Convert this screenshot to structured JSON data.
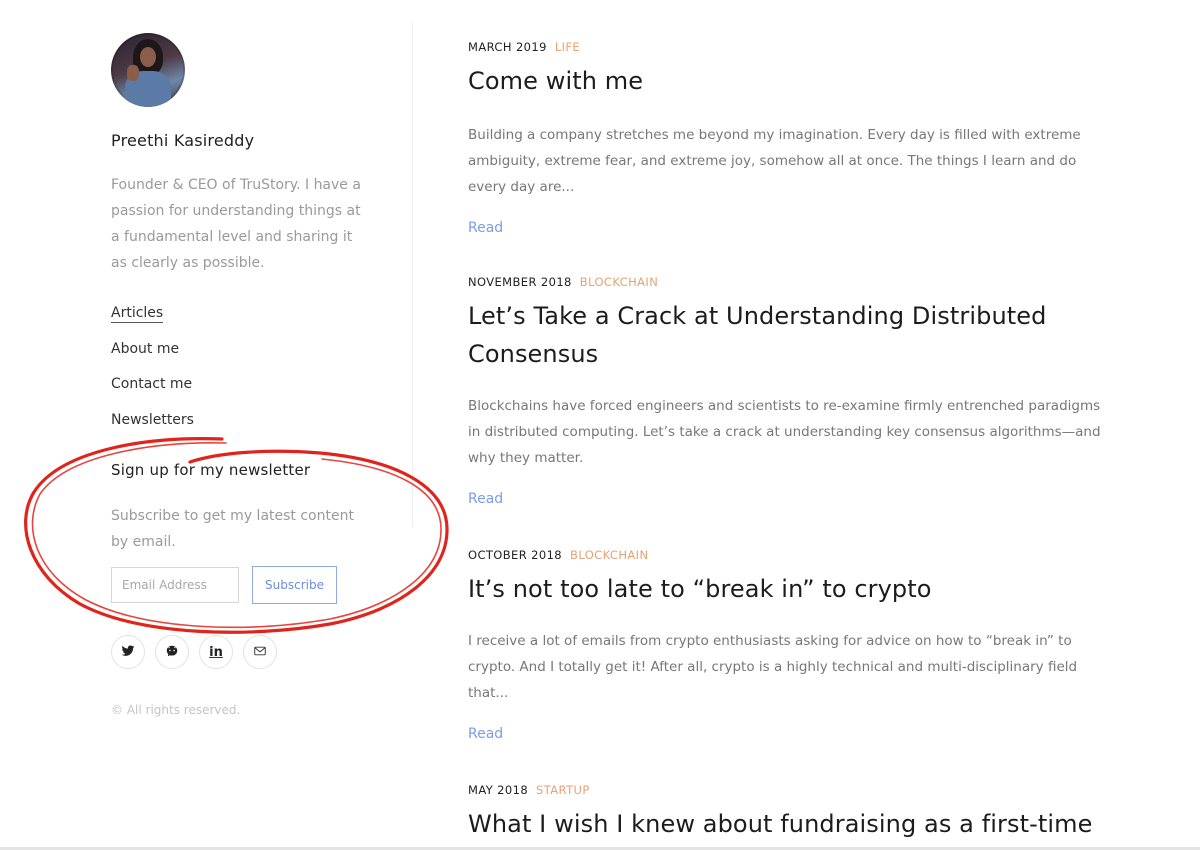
{
  "profile": {
    "name": "Preethi Kasireddy",
    "bio": "Founder & CEO of TruStory. I have a passion for understanding things at a fundamental level and sharing it as clearly as possible."
  },
  "nav": {
    "items": [
      {
        "label": "Articles",
        "active": true
      },
      {
        "label": "About me"
      },
      {
        "label": "Contact me"
      },
      {
        "label": "Newsletters"
      }
    ]
  },
  "newsletter": {
    "title": "Sign up for my newsletter",
    "description": "Subscribe to get my latest content by email.",
    "email_placeholder": "Email Address",
    "subscribe_label": "Subscribe"
  },
  "social": {
    "icons": [
      "twitter-icon",
      "github-icon",
      "linkedin-icon",
      "mail-icon"
    ],
    "linkedin_text": "in"
  },
  "footer": {
    "copyright": "© All rights reserved."
  },
  "colors": {
    "category": "#e4a274",
    "link": "#7b9de6",
    "annotation": "#e0241c"
  },
  "articles": [
    {
      "date": "MARCH 2019",
      "category": "LIFE",
      "title": "Come with me",
      "excerpt": "Building a company stretches me beyond my imagination. Every day is filled with extreme ambiguity, extreme fear, and extreme joy, somehow all at once. The things I learn and do every day are...",
      "read": "Read"
    },
    {
      "date": "NOVEMBER 2018",
      "category": "BLOCKCHAIN",
      "title": "Let’s Take a Crack at Understanding Distributed Consensus",
      "excerpt": "Blockchains have forced engineers and scientists to re-examine firmly entrenched paradigms in distributed computing. Let’s take a crack at understanding key consensus algorithms—and why they matter.",
      "read": "Read"
    },
    {
      "date": "OCTOBER 2018",
      "category": "BLOCKCHAIN",
      "title": "It’s not too late to “break in” to crypto",
      "excerpt": "I receive a lot of emails from crypto enthusiasts asking for advice on how to “break in” to crypto. And I totally get it! After all, crypto is a highly technical and multi-disciplinary field that...",
      "read": "Read"
    },
    {
      "date": "MAY 2018",
      "category": "STARTUP",
      "title": "What I wish I knew about fundraising as a first-time"
    }
  ]
}
